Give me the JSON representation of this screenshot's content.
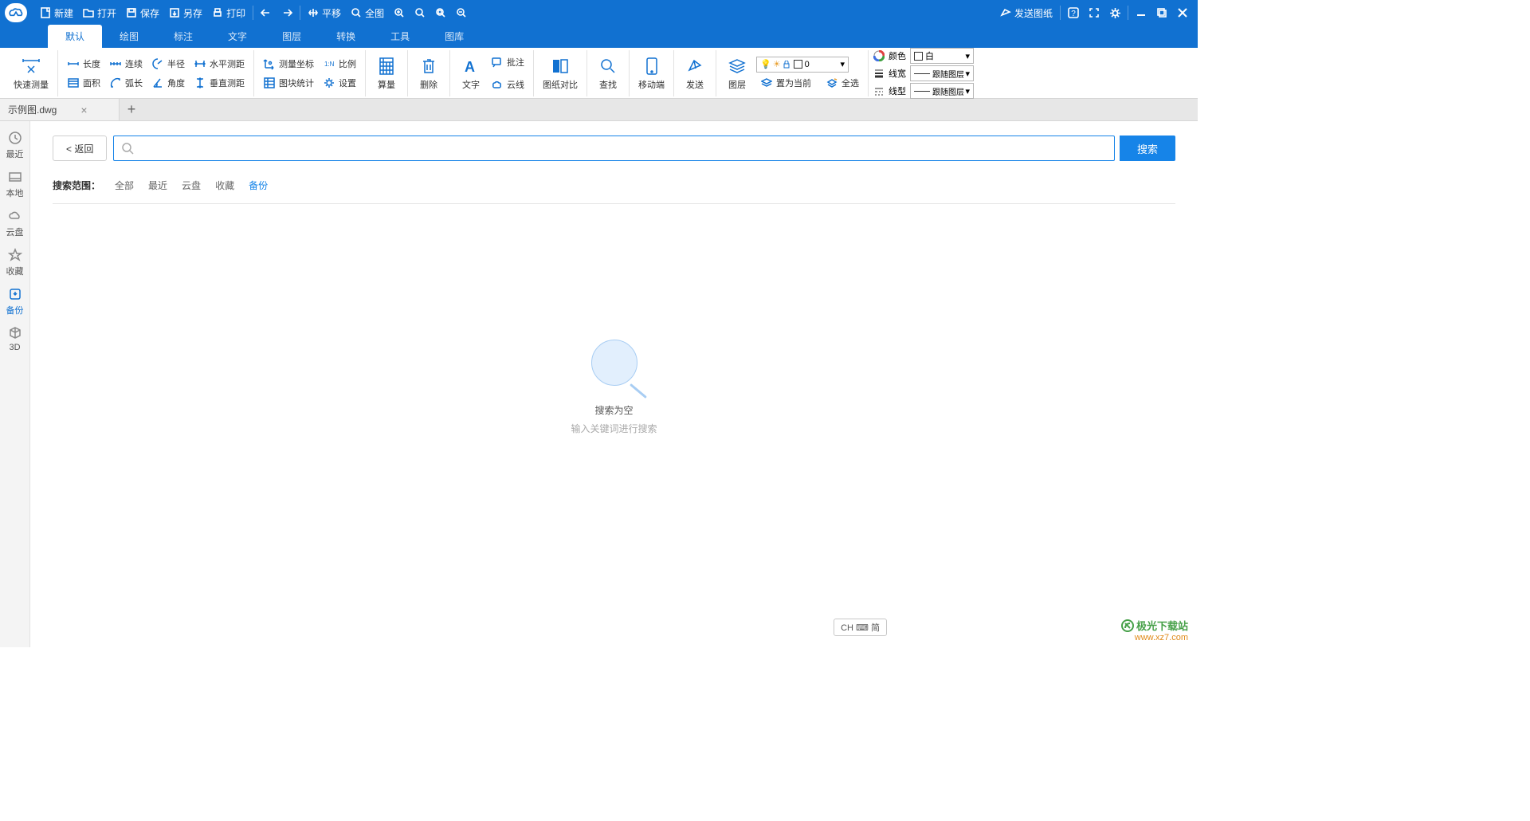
{
  "titlebar": {
    "new_": "新建",
    "open": "打开",
    "save": "保存",
    "saveas": "另存",
    "print": "打印",
    "pan": "平移",
    "full": "全图",
    "send": "发送图纸"
  },
  "menu": {
    "tabs": [
      "默认",
      "绘图",
      "标注",
      "文字",
      "图层",
      "转换",
      "工具",
      "图库"
    ],
    "active": 0
  },
  "ribbon": {
    "quick_measure": "快速测量",
    "length": "长度",
    "continuous": "连续",
    "radius": "半径",
    "hdist": "水平测距",
    "area": "面积",
    "arclen": "弧长",
    "angle": "角度",
    "vdist": "垂直测距",
    "coord": "测量坐标",
    "ratio": "比例",
    "blockstat": "图块统计",
    "settings": "设置",
    "calc": "算量",
    "delete": "删除",
    "text": "文字",
    "annotate": "批注",
    "cloud": "云线",
    "compare": "图纸对比",
    "find": "查找",
    "mobile": "移动端",
    "send2": "发送",
    "layer": "图层",
    "setcur": "置为当前",
    "selectall": "全选",
    "color_lbl": "颜色",
    "color_val": "白",
    "linew": "线宽",
    "linew_val": "跟随图层",
    "linetype": "线型",
    "linetype_val": "跟随图层",
    "layercombo_val": "0"
  },
  "filetab": {
    "name": "示例图.dwg"
  },
  "sidebar": {
    "items": [
      {
        "label": "最近"
      },
      {
        "label": "本地"
      },
      {
        "label": "云盘"
      },
      {
        "label": "收藏"
      },
      {
        "label": "备份"
      },
      {
        "label": "3D"
      }
    ],
    "active": 4
  },
  "search": {
    "back": "< 返回",
    "placeholder": "",
    "value": "",
    "button": "搜索",
    "scope_label": "搜索范围：",
    "scope": [
      "全部",
      "最近",
      "云盘",
      "收藏",
      "备份"
    ],
    "scope_active": 4,
    "empty_title": "搜索为空",
    "empty_sub": "输入关键词进行搜索"
  },
  "ime": "CH ⌨ 简",
  "watermark": {
    "name": "极光下载站",
    "url": "www.xz7.com"
  }
}
